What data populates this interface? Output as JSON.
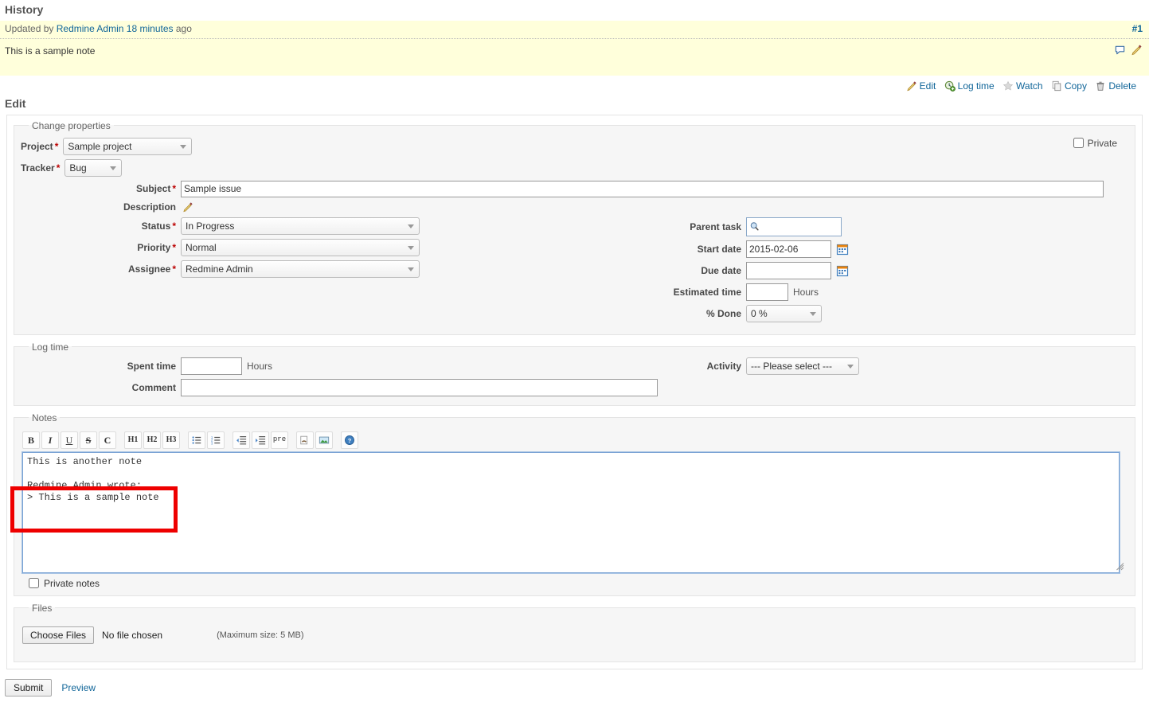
{
  "history": {
    "title": "History",
    "note": {
      "updated_prefix": "Updated by",
      "author": "Redmine Admin",
      "time_ago": "18 minutes",
      "ago_suffix": "ago",
      "journal_anchor": "#1",
      "body": "This is a sample note",
      "icons": [
        "comment-icon",
        "edit-pencil-icon"
      ]
    }
  },
  "contextual": {
    "items": [
      {
        "label": "Edit",
        "icon": "pencil-icon"
      },
      {
        "label": "Log time",
        "icon": "clock-add-icon"
      },
      {
        "label": "Watch",
        "icon": "star-icon"
      },
      {
        "label": "Copy",
        "icon": "copy-icon"
      },
      {
        "label": "Delete",
        "icon": "trash-icon"
      }
    ]
  },
  "edit": {
    "title": "Edit",
    "change_properties": {
      "legend": "Change properties",
      "private_label": "Private",
      "private_checked": false,
      "fields": {
        "project": {
          "label": "Project",
          "required": true,
          "value": "Sample project"
        },
        "tracker": {
          "label": "Tracker",
          "required": true,
          "value": "Bug"
        },
        "subject": {
          "label": "Subject",
          "required": true,
          "value": "Sample issue"
        },
        "description": {
          "label": "Description",
          "icon": "edit-pencil-icon"
        },
        "status": {
          "label": "Status",
          "required": true,
          "value": "In Progress"
        },
        "priority": {
          "label": "Priority",
          "required": true,
          "value": "Normal"
        },
        "assignee": {
          "label": "Assignee",
          "required": true,
          "value": "Redmine Admin"
        },
        "parent_task": {
          "label": "Parent task",
          "value": "",
          "icon": "magnifier-icon"
        },
        "start_date": {
          "label": "Start date",
          "value": "2015-02-06",
          "icon": "calendar-icon"
        },
        "due_date": {
          "label": "Due date",
          "value": "",
          "icon": "calendar-icon"
        },
        "estimated_time": {
          "label": "Estimated time",
          "value": "",
          "unit": "Hours"
        },
        "done_ratio": {
          "label": "% Done",
          "value": "0 %"
        }
      }
    },
    "log_time": {
      "legend": "Log time",
      "spent_time": {
        "label": "Spent time",
        "value": "",
        "unit": "Hours"
      },
      "comment": {
        "label": "Comment",
        "value": ""
      },
      "activity": {
        "label": "Activity",
        "value": "--- Please select ---"
      }
    },
    "notes": {
      "legend": "Notes",
      "toolbar": [
        {
          "name": "bold-icon",
          "glyph": "B",
          "style": "bold"
        },
        {
          "name": "italic-icon",
          "glyph": "I",
          "style": "italic"
        },
        {
          "name": "underline-icon",
          "glyph": "U",
          "style": "underline"
        },
        {
          "name": "strikethrough-icon",
          "glyph": "S",
          "style": "strike"
        },
        {
          "name": "inline-code-icon",
          "glyph": "C",
          "style": "code"
        },
        {
          "name": "heading-1-icon",
          "glyph": "H1",
          "style": "hdr"
        },
        {
          "name": "heading-2-icon",
          "glyph": "H2",
          "style": "hdr"
        },
        {
          "name": "heading-3-icon",
          "glyph": "H3",
          "style": "hdr"
        },
        {
          "name": "unordered-list-icon",
          "glyph": "ul",
          "style": "svg"
        },
        {
          "name": "ordered-list-icon",
          "glyph": "ol",
          "style": "svg"
        },
        {
          "name": "outdent-icon",
          "glyph": "outdent",
          "style": "svg"
        },
        {
          "name": "indent-icon",
          "glyph": "indent",
          "style": "svg"
        },
        {
          "name": "preformatted-icon",
          "glyph": "pre",
          "style": "pre"
        },
        {
          "name": "link-icon",
          "glyph": "link",
          "style": "svg"
        },
        {
          "name": "image-icon",
          "glyph": "image",
          "style": "svg"
        },
        {
          "name": "help-icon",
          "glyph": "?",
          "style": "svg"
        }
      ],
      "textarea_value": "This is another note\n\nRedmine Admin wrote:\n> This is a sample note\n",
      "private_notes_label": "Private notes",
      "private_notes_checked": false
    },
    "files": {
      "legend": "Files",
      "choose_label": "Choose Files",
      "no_file_text": "No file chosen",
      "max_size_text": "(Maximum size: 5 MB)"
    },
    "submit_label": "Submit",
    "preview_label": "Preview"
  },
  "colors": {
    "journal_bg": "#ffffdb",
    "fieldset_bg": "#f6f6f6",
    "link": "#116699",
    "required": "#bb0000",
    "annotation": "#ee0000",
    "focus_border": "#7aa3d4"
  }
}
